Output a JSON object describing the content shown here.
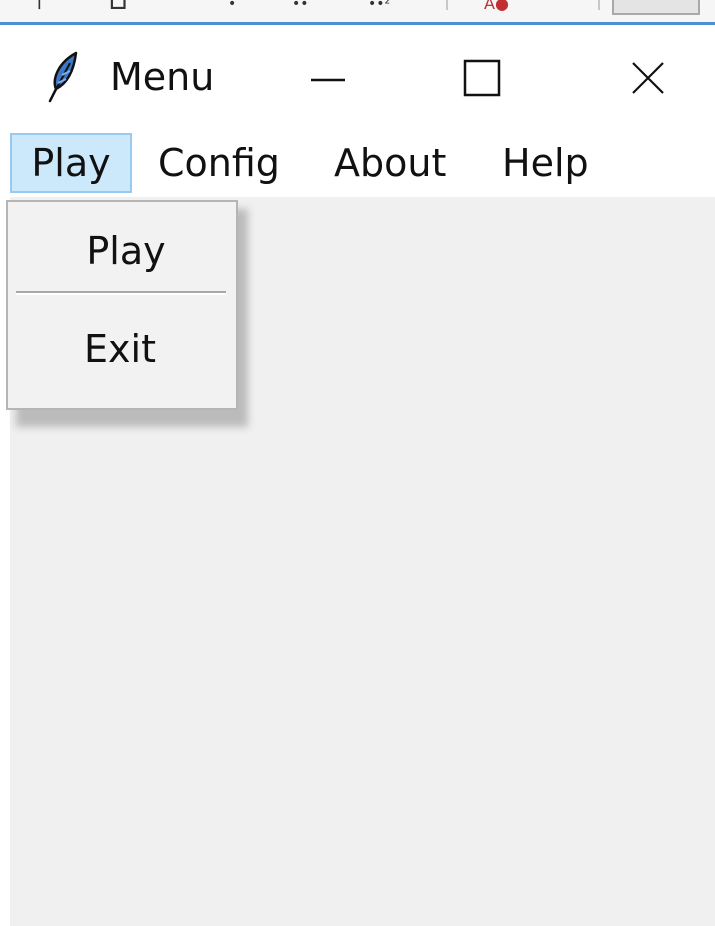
{
  "window": {
    "title": "Menu",
    "controls": {
      "minimize_icon": "minimize-icon",
      "maximize_icon": "maximize-icon",
      "close_icon": "close-icon"
    },
    "app_icon": "feather-icon"
  },
  "menubar": {
    "items": [
      {
        "label": "Play",
        "active": true
      },
      {
        "label": "Config"
      },
      {
        "label": "About"
      },
      {
        "label": "Help"
      }
    ]
  },
  "dropdown": {
    "items": [
      {
        "label": "Play"
      },
      {
        "label": "Exit"
      }
    ]
  },
  "colors": {
    "active_menu_bg": "#cce8fb",
    "active_menu_border": "#99c9ef",
    "client_bg": "#f0f0f0",
    "window_border": "#4b8fd6"
  }
}
